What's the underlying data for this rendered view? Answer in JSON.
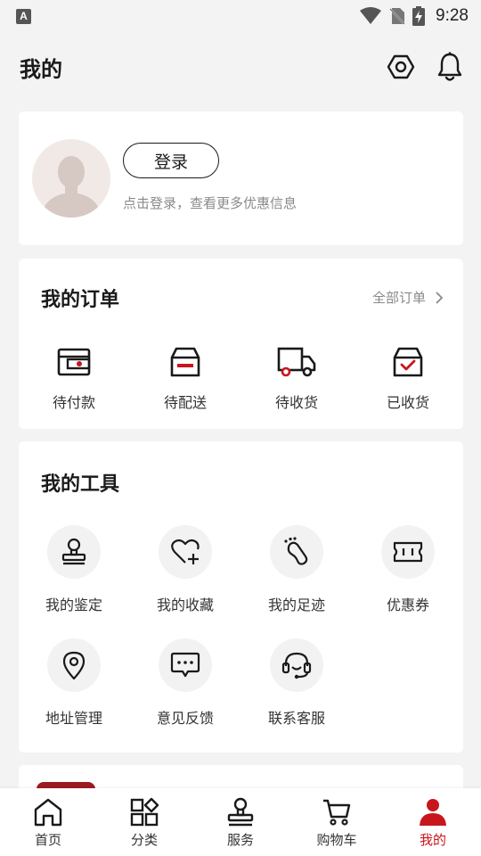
{
  "status_bar": {
    "time": "9:28",
    "notification_letter": "A"
  },
  "header": {
    "title": "我的",
    "settings_icon": "settings-hex-icon",
    "bell_icon": "bell-icon"
  },
  "profile": {
    "login_label": "登录",
    "hint": "点击登录，查看更多优惠信息"
  },
  "orders": {
    "title": "我的订单",
    "all_label": "全部订单",
    "items": [
      {
        "label": "待付款",
        "icon": "wallet-icon"
      },
      {
        "label": "待配送",
        "icon": "box-icon"
      },
      {
        "label": "待收货",
        "icon": "truck-icon"
      },
      {
        "label": "已收货",
        "icon": "box-check-icon"
      }
    ]
  },
  "tools": {
    "title": "我的工具",
    "items": [
      {
        "label": "我的鉴定",
        "icon": "stamp-icon"
      },
      {
        "label": "我的收藏",
        "icon": "heart-plus-icon"
      },
      {
        "label": "我的足迹",
        "icon": "footprint-icon"
      },
      {
        "label": "优惠券",
        "icon": "ticket-icon"
      },
      {
        "label": "地址管理",
        "icon": "location-pin-icon"
      },
      {
        "label": "意见反馈",
        "icon": "chat-bubble-icon"
      },
      {
        "label": "联系客服",
        "icon": "headset-icon"
      }
    ]
  },
  "tabbar": {
    "tabs": [
      {
        "label": "首页",
        "icon": "home-icon"
      },
      {
        "label": "分类",
        "icon": "category-icon"
      },
      {
        "label": "服务",
        "icon": "stamp-icon"
      },
      {
        "label": "购物车",
        "icon": "cart-icon"
      },
      {
        "label": "我的",
        "icon": "user-icon"
      }
    ],
    "active_index": 4
  },
  "colors": {
    "accent": "#c8161d",
    "background": "#f3f3f3",
    "card": "#ffffff",
    "muted_text": "#8a8a8a"
  }
}
